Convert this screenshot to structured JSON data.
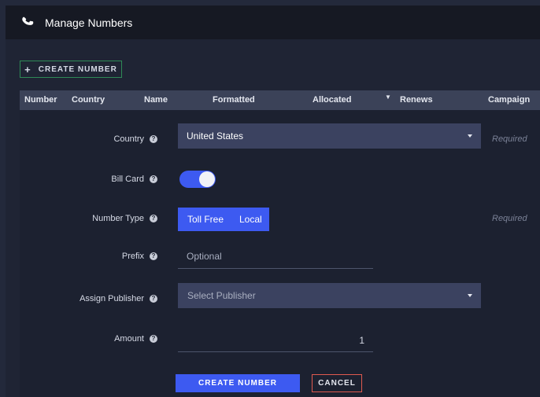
{
  "header": {
    "title": "Manage Numbers",
    "icon": "phone-icon"
  },
  "toolbar": {
    "create_button_label": "CREATE NUMBER",
    "create_button_icon": "plus-icon"
  },
  "table": {
    "columns": [
      "Number",
      "Country",
      "Name",
      "Formatted",
      "Allocated",
      "Renews",
      "Campaign"
    ],
    "sorted_column": "Allocated"
  },
  "form": {
    "country": {
      "label": "Country",
      "value": "United States",
      "required_text": "Required"
    },
    "bill_card": {
      "label": "Bill Card",
      "enabled": true
    },
    "number_type": {
      "label": "Number Type",
      "options": [
        "Toll Free",
        "Local"
      ],
      "required_text": "Required"
    },
    "prefix": {
      "label": "Prefix",
      "placeholder": "Optional"
    },
    "assign_publisher": {
      "label": "Assign Publisher",
      "placeholder": "Select Publisher"
    },
    "amount": {
      "label": "Amount",
      "value": "1"
    },
    "submit_label": "CREATE NUMBER",
    "cancel_label": "CANCEL"
  },
  "colors": {
    "accent": "#3d5af1",
    "cancel_border": "#e05a4f",
    "create_border": "#2e8a56"
  }
}
